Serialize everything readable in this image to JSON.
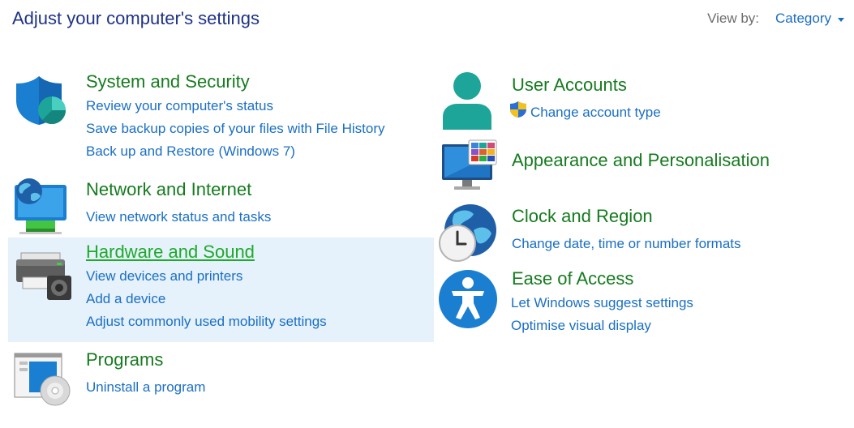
{
  "header": {
    "title": "Adjust your computer's settings",
    "view_by_label": "View by:",
    "view_by_value": "Category"
  },
  "categories": {
    "system": {
      "heading": "System and Security",
      "icon": "shield-icon",
      "links": [
        "Review your computer's status",
        "Save backup copies of your files with File History",
        "Back up and Restore (Windows 7)"
      ]
    },
    "network": {
      "heading": "Network and Internet",
      "icon": "network-globe-icon",
      "links": [
        "View network status and tasks"
      ]
    },
    "hardware": {
      "heading": "Hardware and Sound",
      "icon": "printer-speaker-icon",
      "links": [
        "View devices and printers",
        "Add a device",
        "Adjust commonly used mobility settings"
      ]
    },
    "programs": {
      "heading": "Programs",
      "icon": "programs-disc-icon",
      "links": [
        "Uninstall a program"
      ]
    },
    "users": {
      "heading": "User Accounts",
      "icon": "user-icon",
      "links": [
        "Change account type"
      ]
    },
    "appearance": {
      "heading": "Appearance and Personalisation",
      "icon": "monitor-palette-icon",
      "links": []
    },
    "clock": {
      "heading": "Clock and Region",
      "icon": "clock-globe-icon",
      "links": [
        "Change date, time or number formats"
      ]
    },
    "ease": {
      "heading": "Ease of Access",
      "icon": "accessibility-icon",
      "links": [
        "Let Windows suggest settings",
        "Optimise visual display"
      ]
    }
  },
  "colors": {
    "title": "#1e3287",
    "heading": "#167b1f",
    "heading_hover": "#1eaa2a",
    "link": "#1a6fc4",
    "hover_background": "#e5f1fb"
  }
}
